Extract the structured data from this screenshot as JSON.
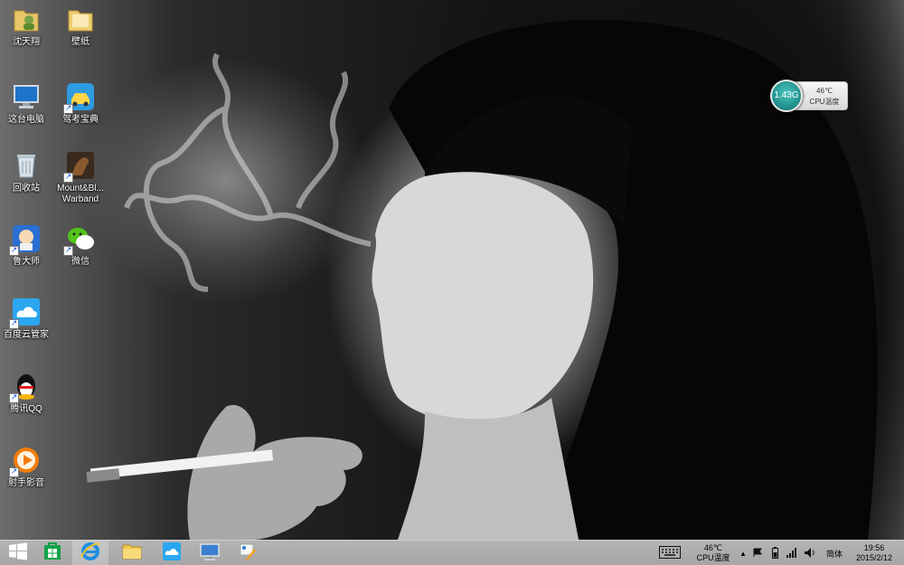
{
  "desktop": {
    "icons": [
      {
        "label": "沈天翔",
        "icon": "user-folder-icon"
      },
      {
        "label": "壁纸",
        "icon": "folder-icon"
      },
      {
        "label": "这台电脑",
        "icon": "computer-icon"
      },
      {
        "label": "驾考宝典",
        "icon": "car-app-icon"
      },
      {
        "label": "回收站",
        "icon": "recycle-bin-icon"
      },
      {
        "label": "Mount&Bl... Warband",
        "icon": "game-horse-icon"
      },
      {
        "label": "鲁大师",
        "icon": "ludashi-icon"
      },
      {
        "label": "微信",
        "icon": "wechat-icon"
      },
      {
        "label": "百度云管家",
        "icon": "baidu-cloud-icon"
      },
      {
        "label": "腾讯QQ",
        "icon": "qq-penguin-icon"
      },
      {
        "label": "射手影音",
        "icon": "media-player-icon"
      }
    ]
  },
  "gadget": {
    "disc_value": "1.43G",
    "temperature": "46℃",
    "label": "CPU温度"
  },
  "taskbar": {
    "pinned": [
      {
        "name": "start",
        "icon": "windows-start-icon"
      },
      {
        "name": "store",
        "icon": "windows-store-icon"
      },
      {
        "name": "internet-explorer",
        "icon": "ie-icon"
      },
      {
        "name": "file-explorer",
        "icon": "file-explorer-icon"
      },
      {
        "name": "baidu-cloud",
        "icon": "baidu-cloud-icon"
      },
      {
        "name": "remote-desktop",
        "icon": "remote-monitor-icon"
      },
      {
        "name": "paint-app",
        "icon": "paint-app-icon"
      }
    ],
    "tray": {
      "keyboard_icon": "touch-keyboard-icon",
      "cpu_temp": "46℃",
      "cpu_label": "CPU温度",
      "ime": "简体",
      "time": "19:56",
      "date": "2015/2/12"
    }
  }
}
